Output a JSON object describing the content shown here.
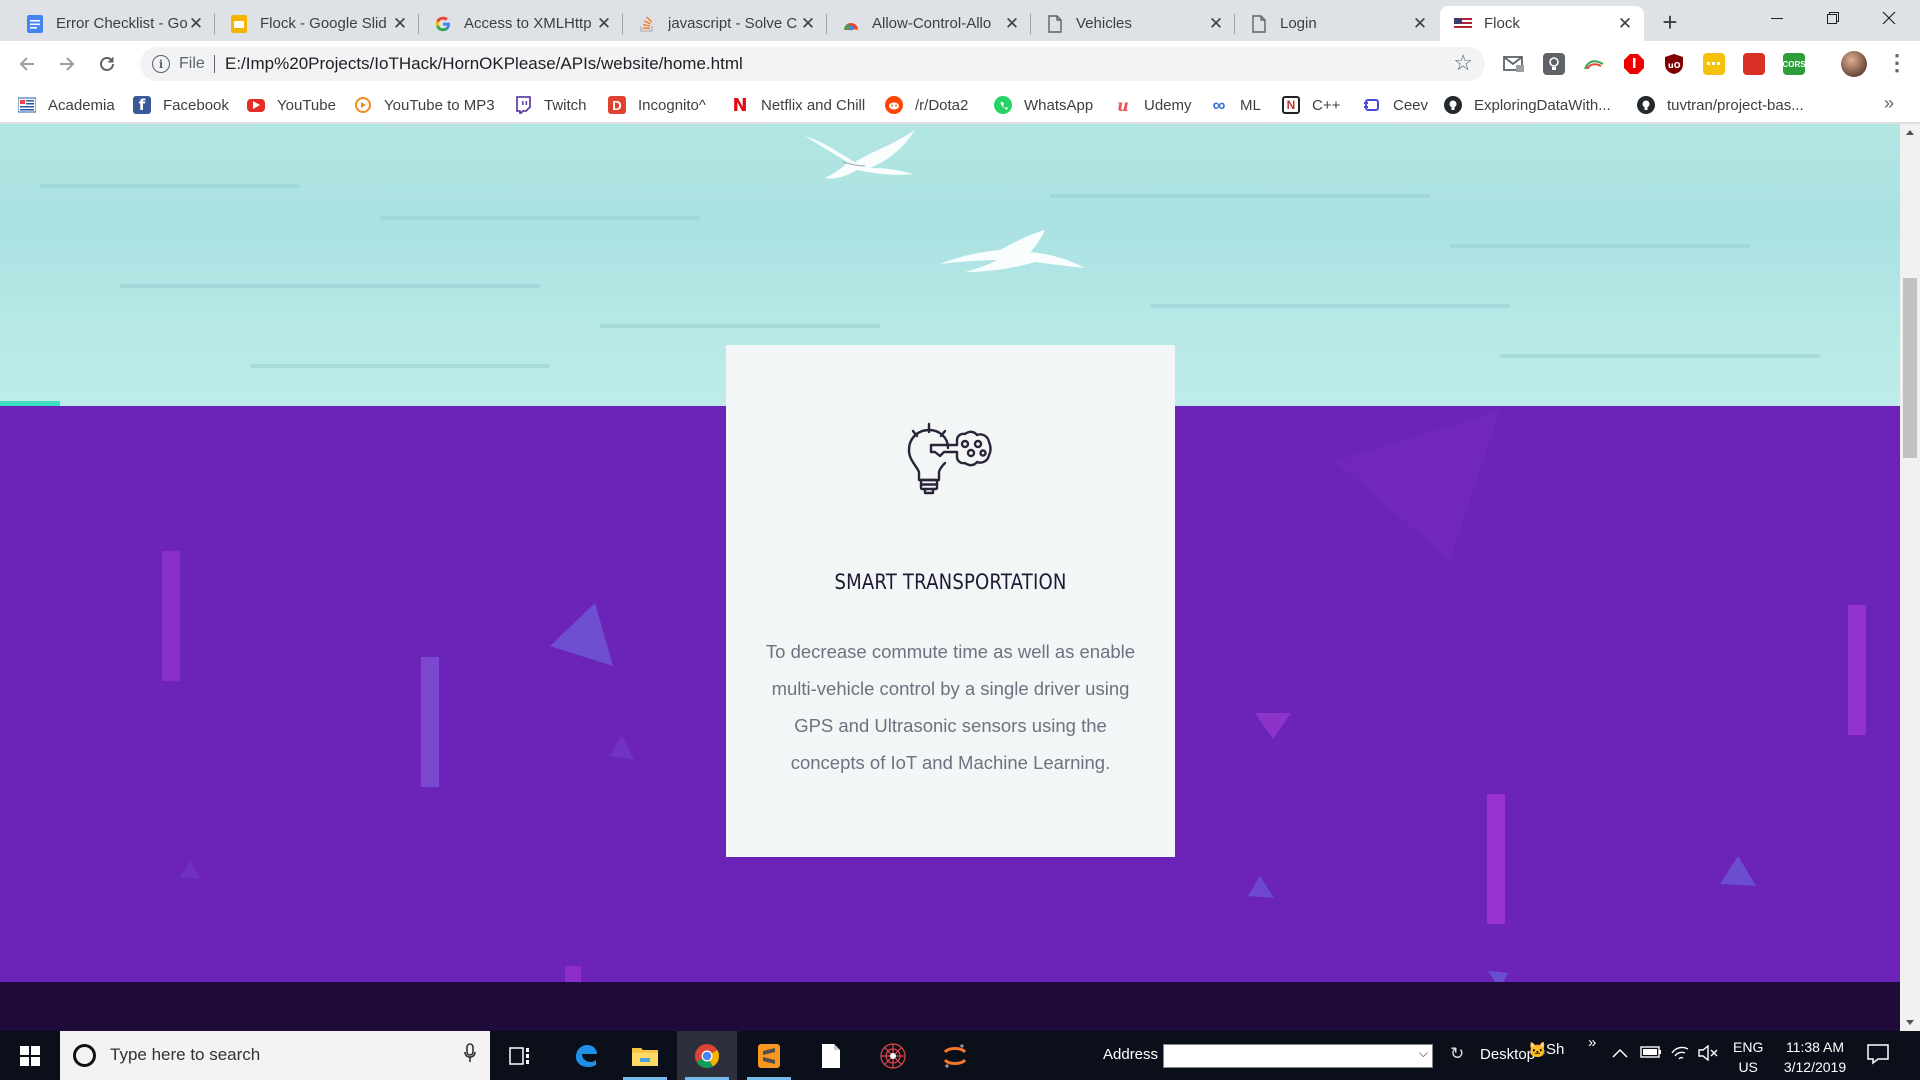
{
  "browser": {
    "tabs": [
      {
        "title": "Error Checklist - Go",
        "icon": "google-docs-icon",
        "color": "#4285f4"
      },
      {
        "title": "Flock - Google Slid",
        "icon": "google-slides-icon",
        "color": "#f4b400"
      },
      {
        "title": "Access to XMLHttp",
        "icon": "google-g-icon",
        "color": "#4285f4"
      },
      {
        "title": "javascript - Solve C",
        "icon": "stackoverflow-icon",
        "color": "#f48024"
      },
      {
        "title": "Allow-Control-Allo",
        "icon": "chrome-store-icon",
        "color": "#34a853"
      },
      {
        "title": "Vehicles",
        "icon": "document-icon",
        "color": "#5f6368"
      },
      {
        "title": "Login",
        "icon": "document-icon",
        "color": "#5f6368"
      },
      {
        "title": "Flock",
        "icon": "flag-icon",
        "color": "#b22234"
      }
    ],
    "active_tab_index": 7,
    "new_tab_label": "+",
    "address": {
      "scheme": "File",
      "url": "E:/Imp%20Projects/IoTHack/HornOKPlease/APIs/website/home.html"
    },
    "bookmarks": [
      {
        "label": "Academia",
        "icon": "academia-icon",
        "color": "#1f5aa8"
      },
      {
        "label": "Facebook",
        "icon": "facebook-icon",
        "color": "#3b5998"
      },
      {
        "label": "YouTube",
        "icon": "youtube-icon",
        "color": "#e52d27"
      },
      {
        "label": "YouTube to MP3",
        "icon": "mp3-icon",
        "color": "#f28b1e"
      },
      {
        "label": "Twitch",
        "icon": "twitch-icon",
        "color": "#6441a5"
      },
      {
        "label": "Incognito^",
        "icon": "incognito-icon",
        "color": "#e0422f"
      },
      {
        "label": "Netflix and Chill",
        "icon": "netflix-icon",
        "color": "#e50914"
      },
      {
        "label": "/r/Dota2",
        "icon": "reddit-icon",
        "color": "#ff4500"
      },
      {
        "label": "WhatsApp",
        "icon": "whatsapp-icon",
        "color": "#25d366"
      },
      {
        "label": "Udemy",
        "icon": "udemy-icon",
        "color": "#ec5252"
      },
      {
        "label": "ML",
        "icon": "infinity-icon",
        "color": "#3b6fd8"
      },
      {
        "label": "C++",
        "icon": "notion-icon",
        "color": "#c0392b"
      },
      {
        "label": "Ceev",
        "icon": "ceev-icon",
        "color": "#4a4ad8"
      },
      {
        "label": "ExploringDataWith...",
        "icon": "github-icon",
        "color": "#24292e"
      },
      {
        "label": "tuvtran/project-bas...",
        "icon": "github-icon",
        "color": "#24292e"
      }
    ],
    "bookmarks_more": "»"
  },
  "page": {
    "card": {
      "icon": "lightbulb-key-icon",
      "title": "SMART TRANSPORTATION",
      "text": "To decrease commute time as well as enable multi-vehicle control by a single driver using GPS and Ultrasonic sensors using the concepts of IoT and Machine Learning."
    },
    "colors": {
      "hero_sea": "#b3e6e3",
      "section_purple": "#6c24b8",
      "footer_dark": "#1f0b3a",
      "card_bg": "#f3f6f6",
      "accent_teal": "#3ee0c0"
    }
  },
  "taskbar": {
    "search_placeholder": "Type here to search",
    "address_label": "Address",
    "desktop_label": "Desktop",
    "sh_label": "Sh",
    "sh_more": "»",
    "lang_top": "ENG",
    "lang_bottom": "US",
    "time": "11:38 AM",
    "date": "3/12/2019",
    "apps": [
      "task-view-icon",
      "edge-icon",
      "file-explorer-icon",
      "chrome-icon",
      "sublime-text-icon",
      "notepad-icon",
      "spider-icon",
      "jupyter-icon"
    ]
  }
}
